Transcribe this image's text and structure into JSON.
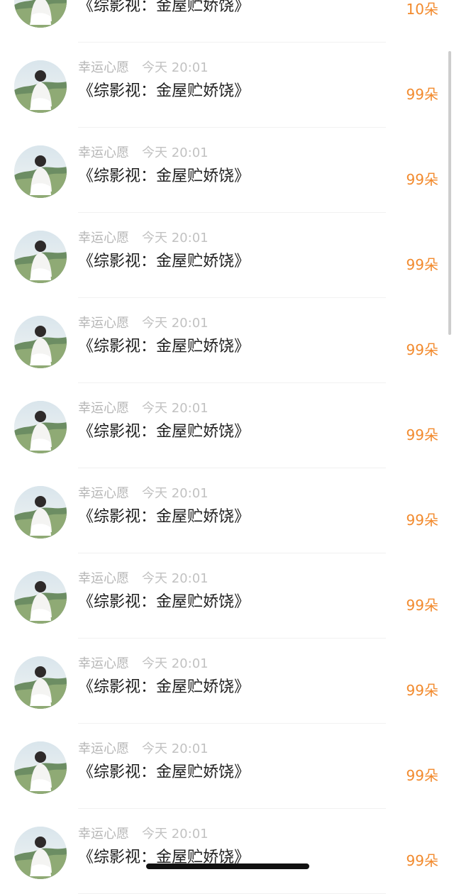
{
  "list": {
    "items": [
      {
        "name": "",
        "time": "",
        "title": "《综影视：金屋贮娇饶》",
        "count": "10朵"
      },
      {
        "name": "幸运心愿",
        "time": "今天 20:01",
        "title": "《综影视：金屋贮娇饶》",
        "count": "99朵"
      },
      {
        "name": "幸运心愿",
        "time": "今天 20:01",
        "title": "《综影视：金屋贮娇饶》",
        "count": "99朵"
      },
      {
        "name": "幸运心愿",
        "time": "今天 20:01",
        "title": "《综影视：金屋贮娇饶》",
        "count": "99朵"
      },
      {
        "name": "幸运心愿",
        "time": "今天 20:01",
        "title": "《综影视：金屋贮娇饶》",
        "count": "99朵"
      },
      {
        "name": "幸运心愿",
        "time": "今天 20:01",
        "title": "《综影视：金屋贮娇饶》",
        "count": "99朵"
      },
      {
        "name": "幸运心愿",
        "time": "今天 20:01",
        "title": "《综影视：金屋贮娇饶》",
        "count": "99朵"
      },
      {
        "name": "幸运心愿",
        "time": "今天 20:01",
        "title": "《综影视：金屋贮娇饶》",
        "count": "99朵"
      },
      {
        "name": "幸运心愿",
        "time": "今天 20:01",
        "title": "《综影视：金屋贮娇饶》",
        "count": "99朵"
      },
      {
        "name": "幸运心愿",
        "time": "今天 20:01",
        "title": "《综影视：金屋贮娇饶》",
        "count": "99朵"
      },
      {
        "name": "幸运心愿",
        "time": "今天 20:01",
        "title": "《综影视：金屋贮娇饶》",
        "count": "99朵"
      }
    ]
  },
  "style": {
    "accent": "#f28a2d",
    "text": "#1f1f1f",
    "muted": "#b8b8b8"
  },
  "icons": {
    "avatar": "user-avatar-photo"
  }
}
